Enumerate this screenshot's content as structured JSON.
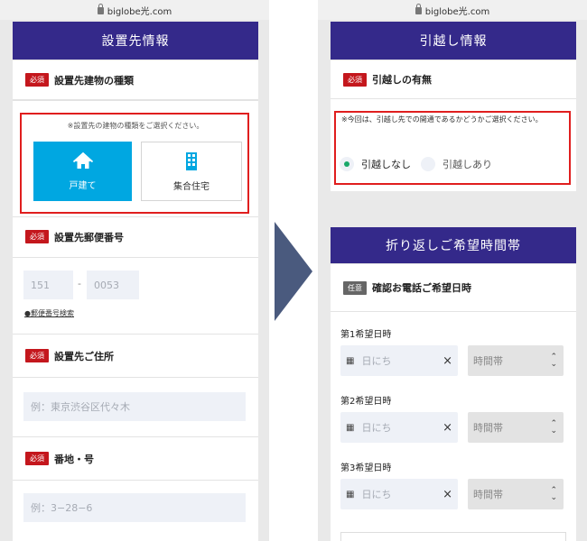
{
  "left": {
    "url": "biglobe光.com",
    "header": "設置先情報",
    "building": {
      "badge": "必須",
      "label": "設置先建物の種類",
      "hint": "※設置先の建物の種類をご選択ください。",
      "options": [
        "戸建て",
        "集合住宅"
      ],
      "selected": "戸建て"
    },
    "postal": {
      "badge": "必須",
      "label": "設置先郵便番号",
      "part1": "151",
      "separator": "-",
      "part2": "0053",
      "search_link": "郵便番号検索"
    },
    "address": {
      "badge": "必須",
      "label": "設置先ご住所",
      "placeholder": "例：東京渋谷区代々木"
    },
    "banchi": {
      "badge": "必須",
      "label": "番地・号",
      "placeholder": "例：3−28−6"
    }
  },
  "right": {
    "url": "biglobe光.com",
    "moving": {
      "header": "引越し情報",
      "badge": "必須",
      "label": "引越しの有無",
      "hint": "※今回は、引越し先での開通であるかどうかご選択ください。",
      "options": [
        "引越しなし",
        "引越しあり"
      ],
      "selected": "引越しなし"
    },
    "callback": {
      "header": "折り返しご希望時間帯",
      "badge": "任意",
      "label": "確認お電話ご希望日時",
      "slots": [
        {
          "label": "第1希望日時",
          "date_placeholder": "日にち",
          "time_placeholder": "時間帯"
        },
        {
          "label": "第2希望日時",
          "date_placeholder": "日にち",
          "time_placeholder": "時間帯"
        },
        {
          "label": "第3希望日時",
          "date_placeholder": "日にち",
          "time_placeholder": "時間帯"
        }
      ],
      "clear_symbol": "×"
    }
  },
  "colors": {
    "header": "#34298a",
    "required": "#c4171d",
    "optional": "#666666",
    "selected": "#00a7e1",
    "highlight": "#e01e1e",
    "arrow": "#4a5a7e",
    "radio_on": "#1aa86a"
  }
}
